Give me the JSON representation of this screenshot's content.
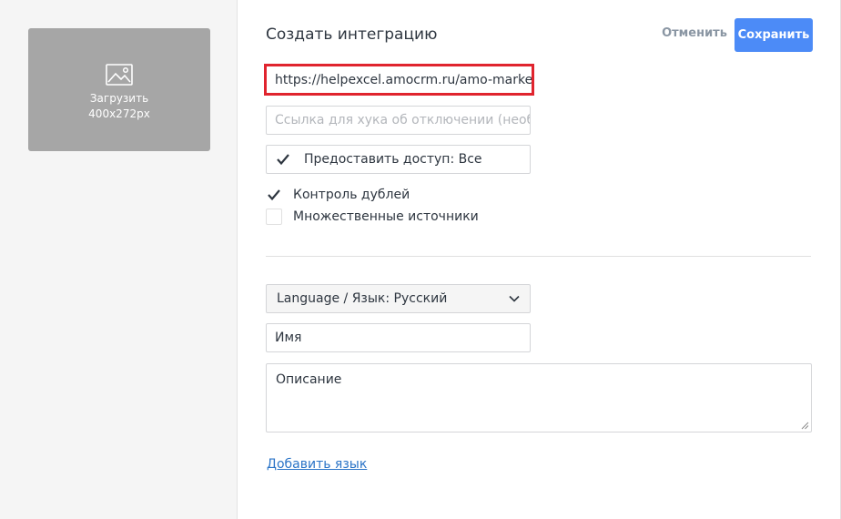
{
  "left": {
    "upload_label": "Загрузить",
    "upload_size": "400x272px",
    "image_icon": "image-icon"
  },
  "header": {
    "title": "Создать интеграцию",
    "cancel_label": "Отменить",
    "save_label": "Сохранить"
  },
  "form": {
    "redirect_url_value": "https://helpexcel.amocrm.ru/amo-market/r",
    "disconnect_hook_placeholder": "Ссылка для хука об отключении (необязательно)",
    "access_label": "Предоставить доступ: Все",
    "access_checked": true,
    "duplicates_label": "Контроль дублей",
    "duplicates_checked": true,
    "multi_sources_label": "Множественные источники",
    "multi_sources_checked": false,
    "language_select": "Language / Язык: Русский",
    "name_placeholder": "Имя",
    "description_placeholder": "Описание",
    "add_language_label": "Добавить язык"
  },
  "colors": {
    "accent": "#4c8bf7",
    "highlight": "#e0242e",
    "link": "#2b74c7"
  }
}
